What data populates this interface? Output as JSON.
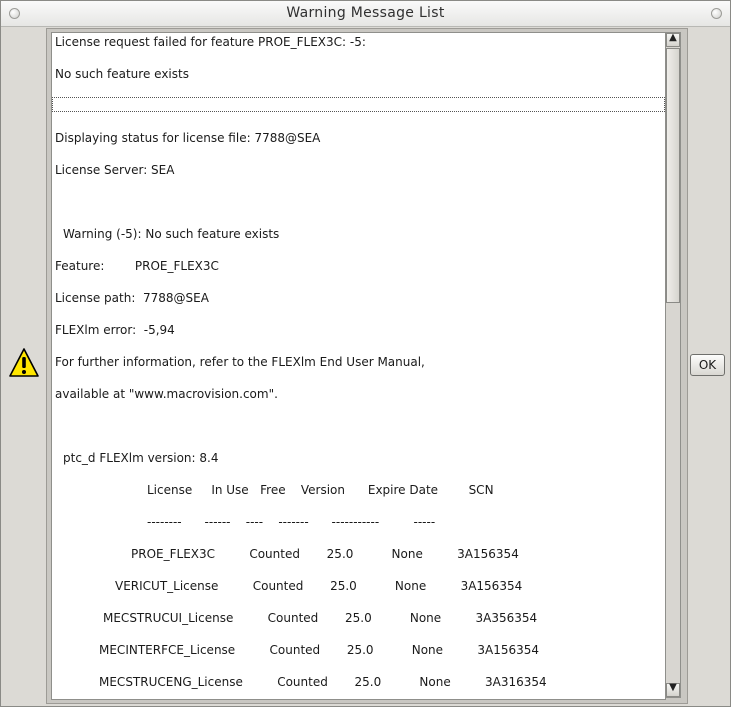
{
  "window": {
    "title": "Warning Message List"
  },
  "message_lines": [
    {
      "text": "License request failed for feature PROE_FLEX3C: -5:",
      "indent": 0
    },
    {
      "text": "No such feature exists",
      "indent": 0
    },
    {
      "text": "Displaying status for license file: 7788@SEA",
      "indent": 0
    },
    {
      "text": "License Server: SEA",
      "indent": 0
    },
    {
      "text": "Warning (-5): No such feature exists",
      "indent": 8
    },
    {
      "text": "Feature:        PROE_FLEX3C",
      "indent": 0
    },
    {
      "text": "License path:  7788@SEA",
      "indent": 0
    },
    {
      "text": "FLEXlm error:  -5,94",
      "indent": 0
    },
    {
      "text": "For further information, refer to the FLEXlm End User Manual,",
      "indent": 0
    },
    {
      "text": "available at \"www.macrovision.com\".",
      "indent": 0
    },
    {
      "text": "ptc_d FLEXlm version: 8.4",
      "indent": 8
    },
    {
      "text": "License     In Use   Free    Version      Expire Date        SCN",
      "indent": 92
    },
    {
      "text": "--------      ------    ----    -------      -----------         -----",
      "indent": 92
    },
    {
      "text": "PROE_FLEX3C         Counted       25.0          None         3A156354",
      "indent": 76
    },
    {
      "text": "VERICUT_License         Counted       25.0          None         3A156354",
      "indent": 60
    },
    {
      "text": "MECSTRUCUI_License         Counted       25.0          None         3A356354",
      "indent": 48
    },
    {
      "text": "MECINTERFCE_License         Counted       25.0          None         3A156354",
      "indent": 44
    },
    {
      "text": "MECSTRUCENG_License         Counted       25.0          None         3A316354",
      "indent": 44
    }
  ],
  "buttons": {
    "ok_label": "OK"
  },
  "icons": {
    "warning": "warning-triangle-icon",
    "scroll_up": "arrow-up-icon",
    "scroll_down": "arrow-down-icon"
  },
  "colors": {
    "warning_yellow": "#ffe600",
    "background": "#dcdad5"
  }
}
